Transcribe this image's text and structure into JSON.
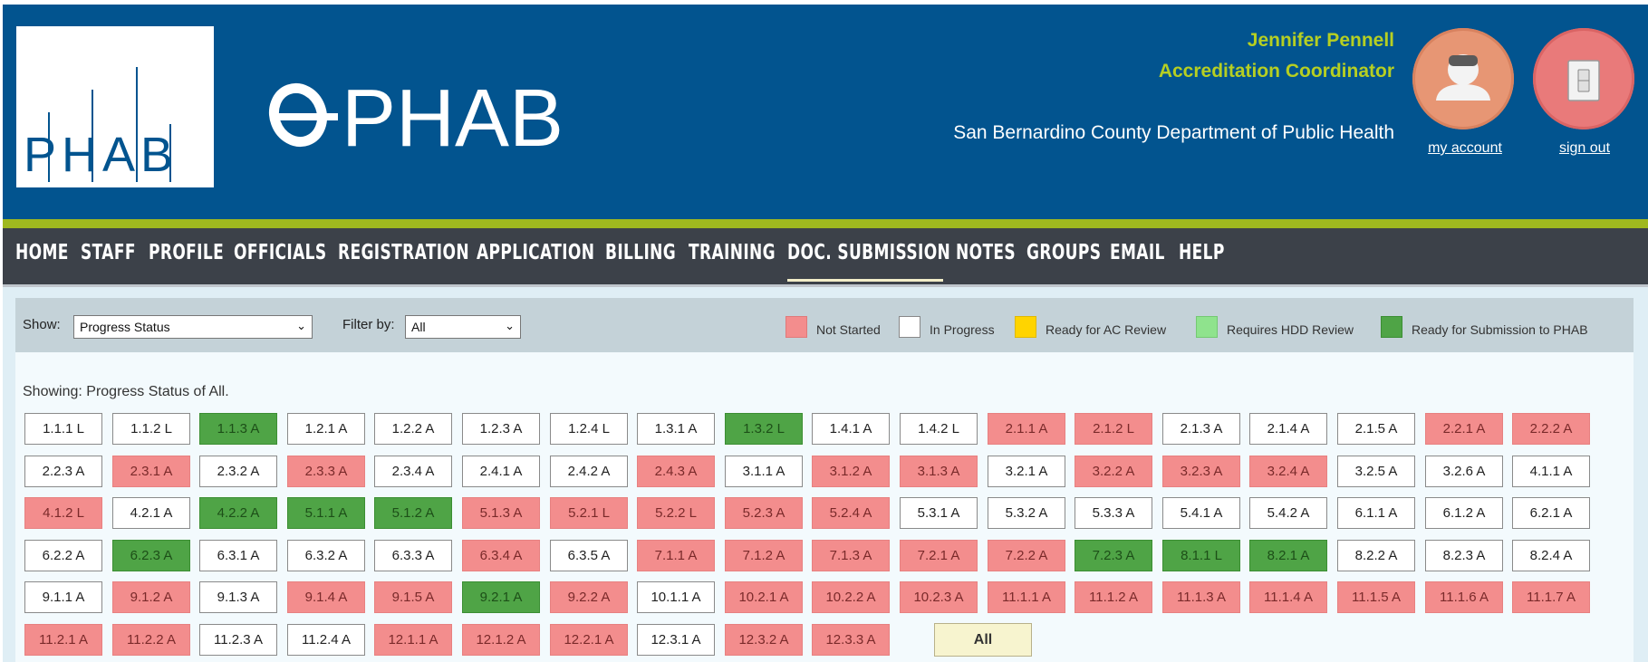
{
  "header": {
    "user_name": "Jennifer Pennell",
    "user_role": "Accreditation Coordinator",
    "org_name": "San Bernardino County Department of Public Health",
    "account_link": "my account",
    "signout_link": "sign out",
    "logo_text": "PHAB",
    "app_name": "PHAB"
  },
  "nav": {
    "items": [
      "HOME",
      "STAFF",
      "PROFILE",
      "OFFICIALS",
      "REGISTRATION",
      "APPLICATION",
      "BILLING",
      "TRAINING",
      "DOC. SUBMISSION",
      "NOTES",
      "GROUPS",
      "EMAIL",
      "HELP"
    ],
    "active": "DOC. SUBMISSION"
  },
  "toolbar": {
    "show_label": "Show:",
    "show_value": "Progress Status",
    "filter_label": "Filter by:",
    "filter_value": "All"
  },
  "legend": [
    {
      "label": "Not Started",
      "color": "#f38d8d"
    },
    {
      "label": "In Progress",
      "color": "#ffffff"
    },
    {
      "label": "Ready for AC Review",
      "color": "#ffd400"
    },
    {
      "label": "Requires HDD Review",
      "color": "#8fe38d"
    },
    {
      "label": "Ready for Submission to PHAB",
      "color": "#4fa446"
    }
  ],
  "showing_text": "Showing: Progress Status of All.",
  "status_colors": {
    "ns": "#f38d8d",
    "ip": "#ffffff",
    "rs": "#4fa446"
  },
  "measures": [
    [
      [
        "1.1.1 L",
        "ip"
      ],
      [
        "1.1.2 L",
        "ip"
      ],
      [
        "1.1.3 A",
        "rs"
      ],
      [
        "1.2.1 A",
        "ip"
      ],
      [
        "1.2.2 A",
        "ip"
      ],
      [
        "1.2.3 A",
        "ip"
      ],
      [
        "1.2.4 L",
        "ip"
      ],
      [
        "1.3.1 A",
        "ip"
      ],
      [
        "1.3.2 L",
        "rs"
      ],
      [
        "1.4.1 A",
        "ip"
      ],
      [
        "1.4.2 L",
        "ip"
      ],
      [
        "2.1.1 A",
        "ns"
      ],
      [
        "2.1.2 L",
        "ns"
      ],
      [
        "2.1.3 A",
        "ip"
      ],
      [
        "2.1.4 A",
        "ip"
      ],
      [
        "2.1.5 A",
        "ip"
      ],
      [
        "2.2.1 A",
        "ns"
      ],
      [
        "2.2.2 A",
        "ns"
      ]
    ],
    [
      [
        "2.2.3 A",
        "ip"
      ],
      [
        "2.3.1 A",
        "ns"
      ],
      [
        "2.3.2 A",
        "ip"
      ],
      [
        "2.3.3 A",
        "ns"
      ],
      [
        "2.3.4 A",
        "ip"
      ],
      [
        "2.4.1 A",
        "ip"
      ],
      [
        "2.4.2 A",
        "ip"
      ],
      [
        "2.4.3 A",
        "ns"
      ],
      [
        "3.1.1 A",
        "ip"
      ],
      [
        "3.1.2 A",
        "ns"
      ],
      [
        "3.1.3 A",
        "ns"
      ],
      [
        "3.2.1 A",
        "ip"
      ],
      [
        "3.2.2 A",
        "ns"
      ],
      [
        "3.2.3 A",
        "ns"
      ],
      [
        "3.2.4 A",
        "ns"
      ],
      [
        "3.2.5 A",
        "ip"
      ],
      [
        "3.2.6 A",
        "ip"
      ],
      [
        "4.1.1 A",
        "ip"
      ]
    ],
    [
      [
        "4.1.2 L",
        "ns"
      ],
      [
        "4.2.1 A",
        "ip"
      ],
      [
        "4.2.2 A",
        "rs"
      ],
      [
        "5.1.1 A",
        "rs"
      ],
      [
        "5.1.2 A",
        "rs"
      ],
      [
        "5.1.3 A",
        "ns"
      ],
      [
        "5.2.1 L",
        "ns"
      ],
      [
        "5.2.2 L",
        "ns"
      ],
      [
        "5.2.3 A",
        "ns"
      ],
      [
        "5.2.4 A",
        "ns"
      ],
      [
        "5.3.1 A",
        "ip"
      ],
      [
        "5.3.2 A",
        "ip"
      ],
      [
        "5.3.3 A",
        "ip"
      ],
      [
        "5.4.1 A",
        "ip"
      ],
      [
        "5.4.2 A",
        "ip"
      ],
      [
        "6.1.1 A",
        "ip"
      ],
      [
        "6.1.2 A",
        "ip"
      ],
      [
        "6.2.1 A",
        "ip"
      ]
    ],
    [
      [
        "6.2.2 A",
        "ip"
      ],
      [
        "6.2.3 A",
        "rs"
      ],
      [
        "6.3.1 A",
        "ip"
      ],
      [
        "6.3.2 A",
        "ip"
      ],
      [
        "6.3.3 A",
        "ip"
      ],
      [
        "6.3.4 A",
        "ns"
      ],
      [
        "6.3.5 A",
        "ip"
      ],
      [
        "7.1.1 A",
        "ns"
      ],
      [
        "7.1.2 A",
        "ns"
      ],
      [
        "7.1.3 A",
        "ns"
      ],
      [
        "7.2.1 A",
        "ns"
      ],
      [
        "7.2.2 A",
        "ns"
      ],
      [
        "7.2.3 A",
        "rs"
      ],
      [
        "8.1.1 L",
        "rs"
      ],
      [
        "8.2.1 A",
        "rs"
      ],
      [
        "8.2.2 A",
        "ip"
      ],
      [
        "8.2.3 A",
        "ip"
      ],
      [
        "8.2.4 A",
        "ip"
      ]
    ],
    [
      [
        "9.1.1 A",
        "ip"
      ],
      [
        "9.1.2 A",
        "ns"
      ],
      [
        "9.1.3 A",
        "ip"
      ],
      [
        "9.1.4 A",
        "ns"
      ],
      [
        "9.1.5 A",
        "ns"
      ],
      [
        "9.2.1 A",
        "rs"
      ],
      [
        "9.2.2 A",
        "ns"
      ],
      [
        "10.1.1 A",
        "ip"
      ],
      [
        "10.2.1 A",
        "ns"
      ],
      [
        "10.2.2 A",
        "ns"
      ],
      [
        "10.2.3 A",
        "ns"
      ],
      [
        "11.1.1 A",
        "ns"
      ],
      [
        "11.1.2 A",
        "ns"
      ],
      [
        "11.1.3 A",
        "ns"
      ],
      [
        "11.1.4 A",
        "ns"
      ],
      [
        "11.1.5 A",
        "ns"
      ],
      [
        "11.1.6 A",
        "ns"
      ],
      [
        "11.1.7 A",
        "ns"
      ]
    ],
    [
      [
        "11.2.1 A",
        "ns"
      ],
      [
        "11.2.2 A",
        "ns"
      ],
      [
        "11.2.3 A",
        "ip"
      ],
      [
        "11.2.4 A",
        "ip"
      ],
      [
        "12.1.1 A",
        "ns"
      ],
      [
        "12.1.2 A",
        "ns"
      ],
      [
        "12.2.1 A",
        "ns"
      ],
      [
        "12.3.1 A",
        "ip"
      ],
      [
        "12.3.2 A",
        "ns"
      ],
      [
        "12.3.3 A",
        "ns"
      ]
    ]
  ],
  "all_button": "All"
}
